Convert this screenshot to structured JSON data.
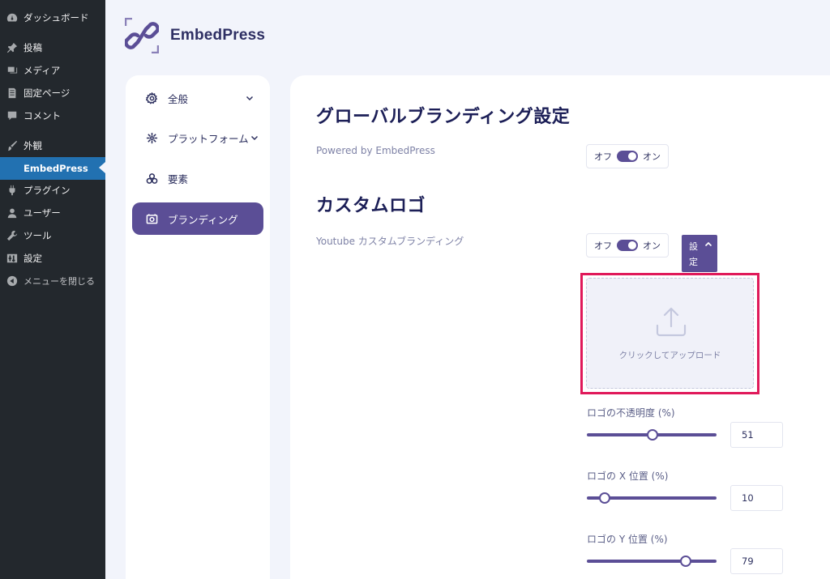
{
  "wp_menu": {
    "dashboard": "ダッシュボード",
    "posts": "投稿",
    "media": "メディア",
    "pages": "固定ページ",
    "comments": "コメント",
    "appearance": "外観",
    "embedpress": "EmbedPress",
    "plugins": "プラグイン",
    "users": "ユーザー",
    "tools": "ツール",
    "settings": "設定",
    "collapse": "メニューを閉じる"
  },
  "brand": {
    "name": "EmbedPress"
  },
  "nav": {
    "general": "全般",
    "platforms": "プラットフォーム",
    "elements": "要素",
    "branding": "ブランディング"
  },
  "global_branding": {
    "heading": "グローバルブランディング設定",
    "powered_label": "Powered by EmbedPress",
    "toggle_off": "オフ",
    "toggle_on": "オン"
  },
  "custom_logo": {
    "heading": "カスタムロゴ",
    "youtube_label": "Youtube カスタムブランディング",
    "toggle_off": "オフ",
    "toggle_on": "オン",
    "settings_line1": "設",
    "settings_line2": "定",
    "upload_text": "クリックしてアップロード"
  },
  "sliders": {
    "opacity_label": "ロゴの不透明度 (%)",
    "opacity_value": "51",
    "x_label": "ロゴの X 位置 (%)",
    "x_value": "10",
    "y_label": "ロゴの Y 位置 (%)",
    "y_value": "79"
  },
  "colors": {
    "accent": "#5b4e96",
    "highlight": "#e0195a",
    "wp_active": "#2271b1"
  }
}
